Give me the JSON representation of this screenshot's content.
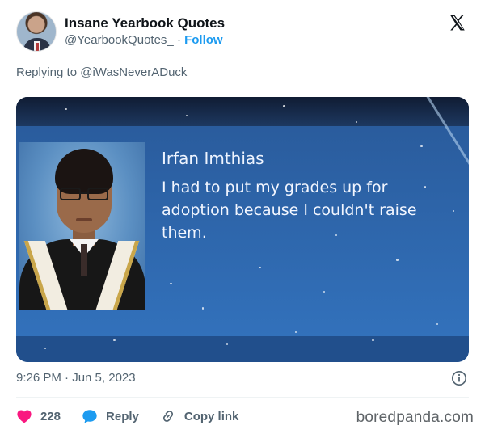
{
  "tweet": {
    "author": {
      "display_name": "Insane Yearbook Quotes",
      "handle": "@YearbookQuotes_",
      "separator": "·",
      "follow_label": "Follow"
    },
    "replying_to": "Replying to @iWasNeverADuck",
    "media": {
      "student_name": "Irfan Imthias",
      "quote": "I had to put my grades up for adoption because I couldn't raise them."
    },
    "timestamp": "9:26 PM · Jun 5, 2023",
    "actions": {
      "like_count": "228",
      "reply_label": "Reply",
      "copy_link_label": "Copy link"
    }
  },
  "watermark": "boredpanda.com",
  "icons": {
    "platform": "x-logo-icon",
    "info": "info-icon",
    "like": "heart-icon",
    "reply": "chat-bubble-icon",
    "copy": "link-icon"
  },
  "colors": {
    "follow": "#1d9bf0",
    "like": "#f91880",
    "reply": "#1d9bf0",
    "secondary_text": "#536471"
  }
}
